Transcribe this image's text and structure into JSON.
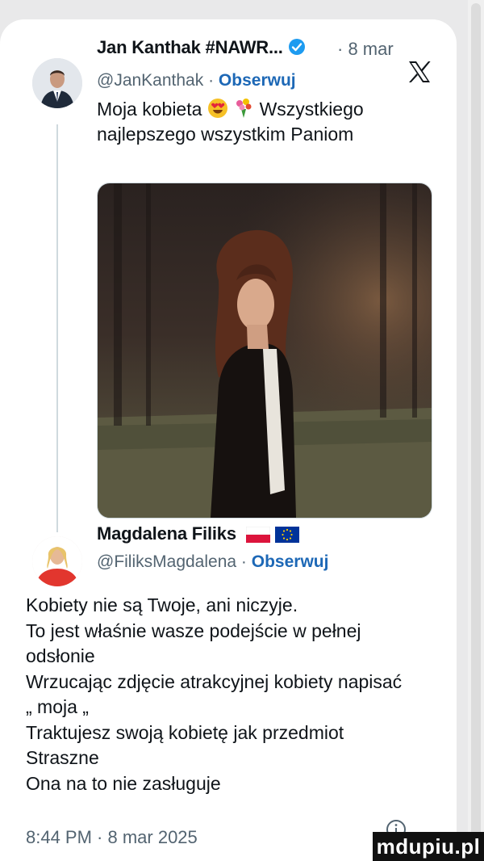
{
  "tweet": {
    "author_name": "Jan Kanthak #NAWR...",
    "time_ago": "· 8 mar",
    "handle": "@JanKanthak",
    "separator": "·",
    "follow_label": "Obserwuj",
    "text_line1_pre": "Moja kobieta",
    "text_line1_post": "Wszystkiego",
    "text_line2": "najlepszego wszystkim Paniom",
    "icons": [
      "verified-badge-icon",
      "x-logo-icon",
      "heart-eyes-emoji-icon",
      "bouquet-emoji-icon"
    ],
    "colors": {
      "follow": "#1d68b6",
      "verified": "#1d9bf0",
      "muted": "#536471"
    }
  },
  "quote": {
    "author_name": "Magdalena Filiks",
    "handle": "@FiliksMagdalena",
    "separator": "·",
    "follow_label": "Obserwuj",
    "flags": [
      "poland-flag-icon",
      "eu-flag-icon"
    ],
    "lines": [
      "Kobiety nie są Twoje, ani niczyje.",
      "To jest właśnie wasze podejście w pełnej",
      "odsłonie",
      "Wrzucając zdjęcie atrakcyjnej kobiety napisać",
      "„ moja „",
      "Traktujesz swoją kobietę jak przedmiot",
      "Straszne",
      "Ona na to nie zasługuje"
    ],
    "timestamp": "8:44 PM · 8 mar 2025"
  },
  "watermark": "mdupiu.pl"
}
